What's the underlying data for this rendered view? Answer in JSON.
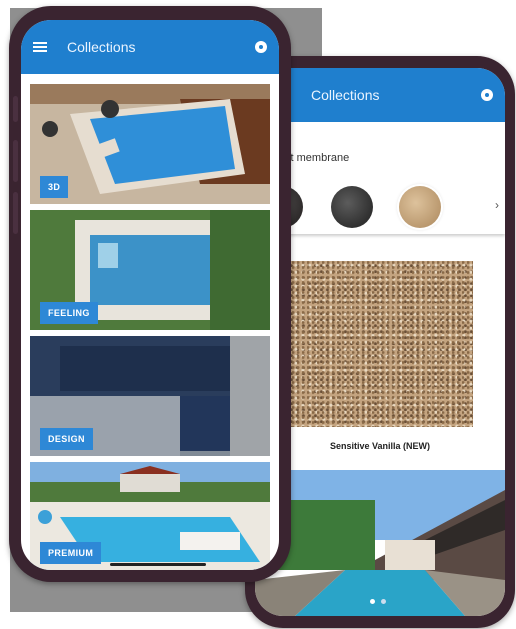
{
  "back_screen": {
    "appbar": {
      "title": "Collections"
    },
    "select_label": "Select membrane",
    "swatches": [
      {
        "name": "charcoal",
        "color": "#3d3a3a"
      },
      {
        "name": "dark-gray",
        "color": "#404040"
      },
      {
        "name": "sand",
        "color": "#cdb08a"
      }
    ],
    "product_name": "Sensitive Vanilla (NEW)",
    "pager": {
      "count": 2,
      "active": 0
    }
  },
  "front_screen": {
    "appbar": {
      "title": "Collections"
    },
    "collections": [
      {
        "label": "3D"
      },
      {
        "label": "FEELING"
      },
      {
        "label": "DESIGN"
      },
      {
        "label": "PREMIUM"
      }
    ]
  },
  "colors": {
    "primary": "#1f7fce",
    "label_bg": "#2e88d6",
    "phone_frame": "#3a2430"
  }
}
